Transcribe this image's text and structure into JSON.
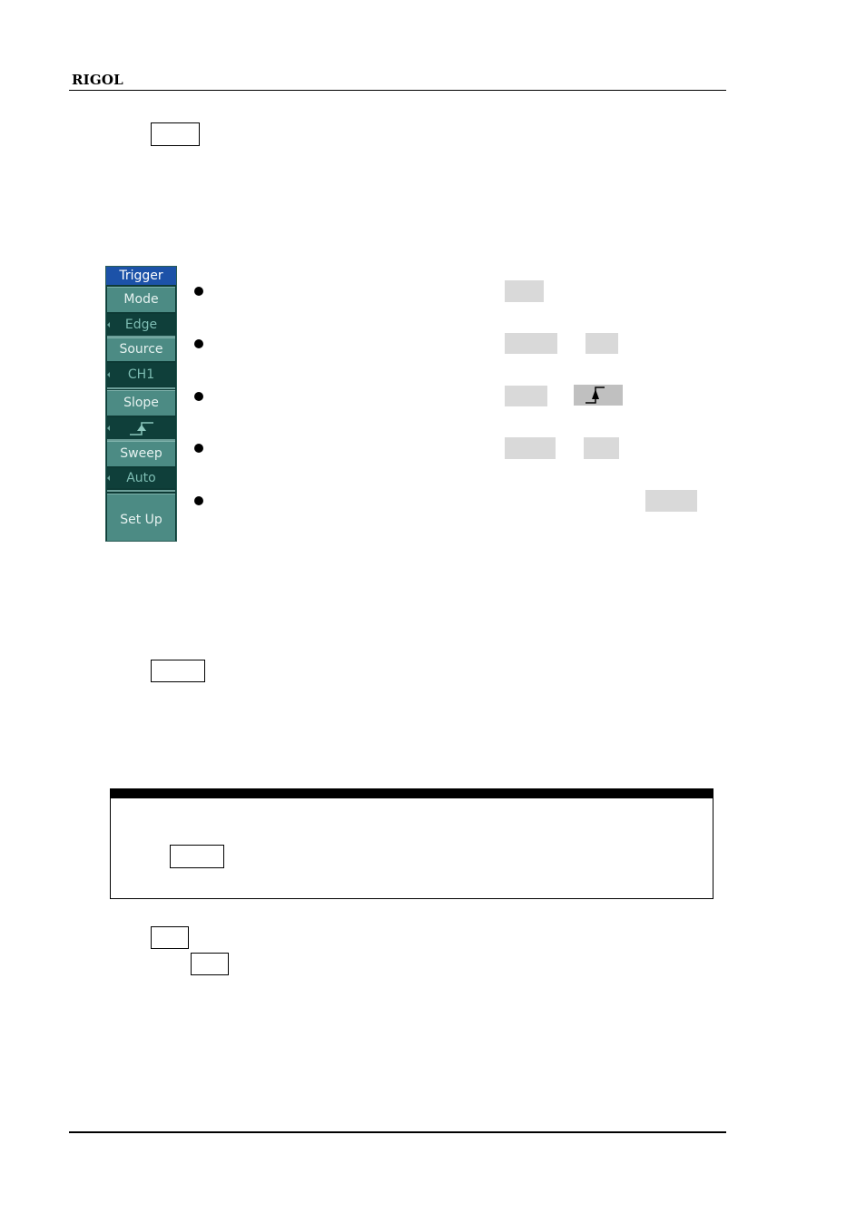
{
  "header": {
    "brand": "RIGOL"
  },
  "key_boxes": {
    "top_key": "",
    "middle_key": "",
    "note_key": "",
    "lower_key_1": "",
    "lower_key_2": ""
  },
  "trigger_menu": {
    "title": "Trigger",
    "items": [
      {
        "label": "Mode",
        "value": "Edge"
      },
      {
        "label": "Source",
        "value": "CH1"
      },
      {
        "label": "Slope",
        "value": "rising-edge-icon"
      },
      {
        "label": "Sweep",
        "value": "Auto"
      },
      {
        "label": "Set Up",
        "value": ""
      }
    ],
    "colors": {
      "title_bg": "#1c52a8",
      "label_bg": "#4c8b84",
      "value_bg": "#0f3f3a",
      "value_text": "#7dbdb3"
    }
  },
  "bullets": [
    {
      "highlights": [
        ""
      ]
    },
    {
      "highlights": [
        "",
        ""
      ]
    },
    {
      "highlights": [
        "",
        "rising-edge-icon"
      ]
    },
    {
      "highlights": [
        "",
        ""
      ]
    },
    {
      "highlights": [
        ""
      ]
    }
  ],
  "note": {
    "title": "",
    "key": ""
  }
}
